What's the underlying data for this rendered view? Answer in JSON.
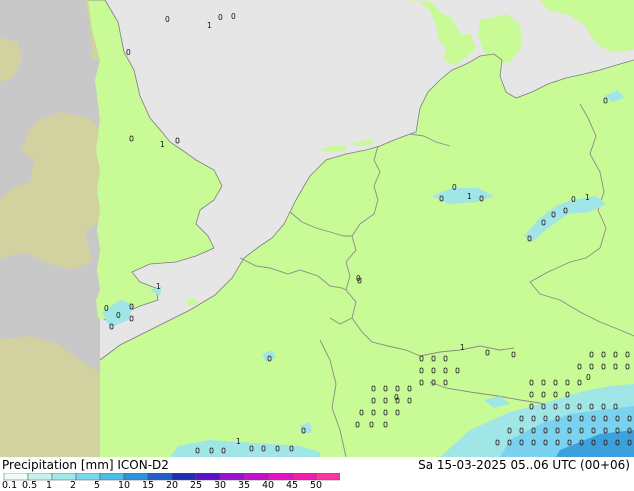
{
  "title_left": "Precipitation [mm]  ICON-D2",
  "title_right": "Sa 15-03-2025 05..06 UTC (00+06)",
  "scale": {
    "labels": [
      "0.1",
      "0.5",
      "1",
      "2",
      "5",
      "10",
      "15",
      "20",
      "25",
      "30",
      "35",
      "40",
      "45",
      "50"
    ],
    "colors": [
      "#f2fcf8",
      "#c7f2ec",
      "#a1e8e8",
      "#7ad8ec",
      "#4dbde6",
      "#2f92dc",
      "#2060c8",
      "#1f2fb0",
      "#5a12c4",
      "#9a10d0",
      "#c412c8",
      "#e414c4",
      "#f41ab2",
      "#fb36a0"
    ]
  },
  "colors": {
    "sea": "#e6e6e6",
    "land": "#c8fa96",
    "outside_domain": "#c8c8c8",
    "outside_domain_land": "#d2d2a0",
    "precip_light": "#a0e6e6",
    "precip_moderate": "#7ad2ee",
    "precip_dark": "#3ca0dc"
  },
  "grid_labels": [
    "0",
    "1",
    "0",
    "0",
    "1",
    "0",
    "0",
    "1",
    "1",
    "0",
    "0",
    "1",
    "0",
    "0",
    "1",
    "0",
    "0",
    "1"
  ]
}
